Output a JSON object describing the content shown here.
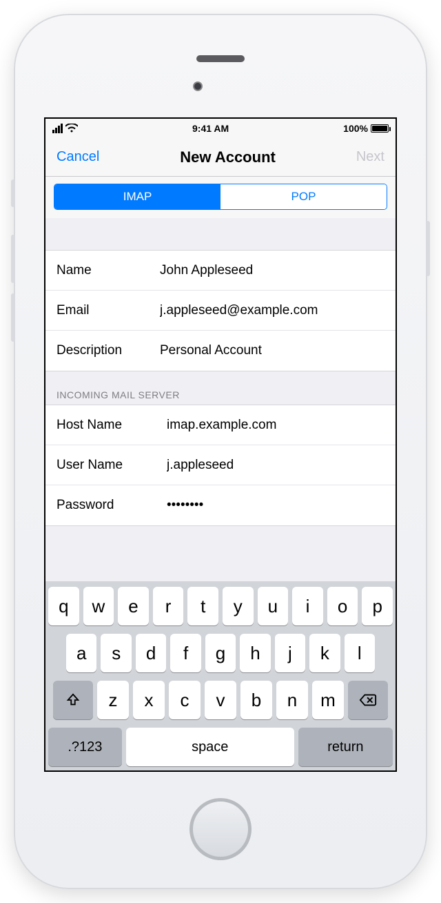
{
  "status": {
    "time": "9:41 AM",
    "battery_pct": "100%"
  },
  "nav": {
    "cancel": "Cancel",
    "title": "New Account",
    "next": "Next"
  },
  "segments": {
    "imap": "IMAP",
    "pop": "POP"
  },
  "account": {
    "name_label": "Name",
    "name_value": "John Appleseed",
    "email_label": "Email",
    "email_value": "j.appleseed@example.com",
    "desc_label": "Description",
    "desc_value": "Personal Account"
  },
  "sections": {
    "incoming_header": "Incoming Mail Server"
  },
  "incoming": {
    "host_label": "Host Name",
    "host_value": "imap.example.com",
    "user_label": "User Name",
    "user_value": "j.appleseed",
    "pass_label": "Password",
    "pass_value": "••••••••"
  },
  "keyboard": {
    "row1": [
      "q",
      "w",
      "e",
      "r",
      "t",
      "y",
      "u",
      "i",
      "o",
      "p"
    ],
    "row2": [
      "a",
      "s",
      "d",
      "f",
      "g",
      "h",
      "j",
      "k",
      "l"
    ],
    "row3": [
      "z",
      "x",
      "c",
      "v",
      "b",
      "n",
      "m"
    ],
    "numkey": ".?123",
    "space": "space",
    "return": "return"
  }
}
